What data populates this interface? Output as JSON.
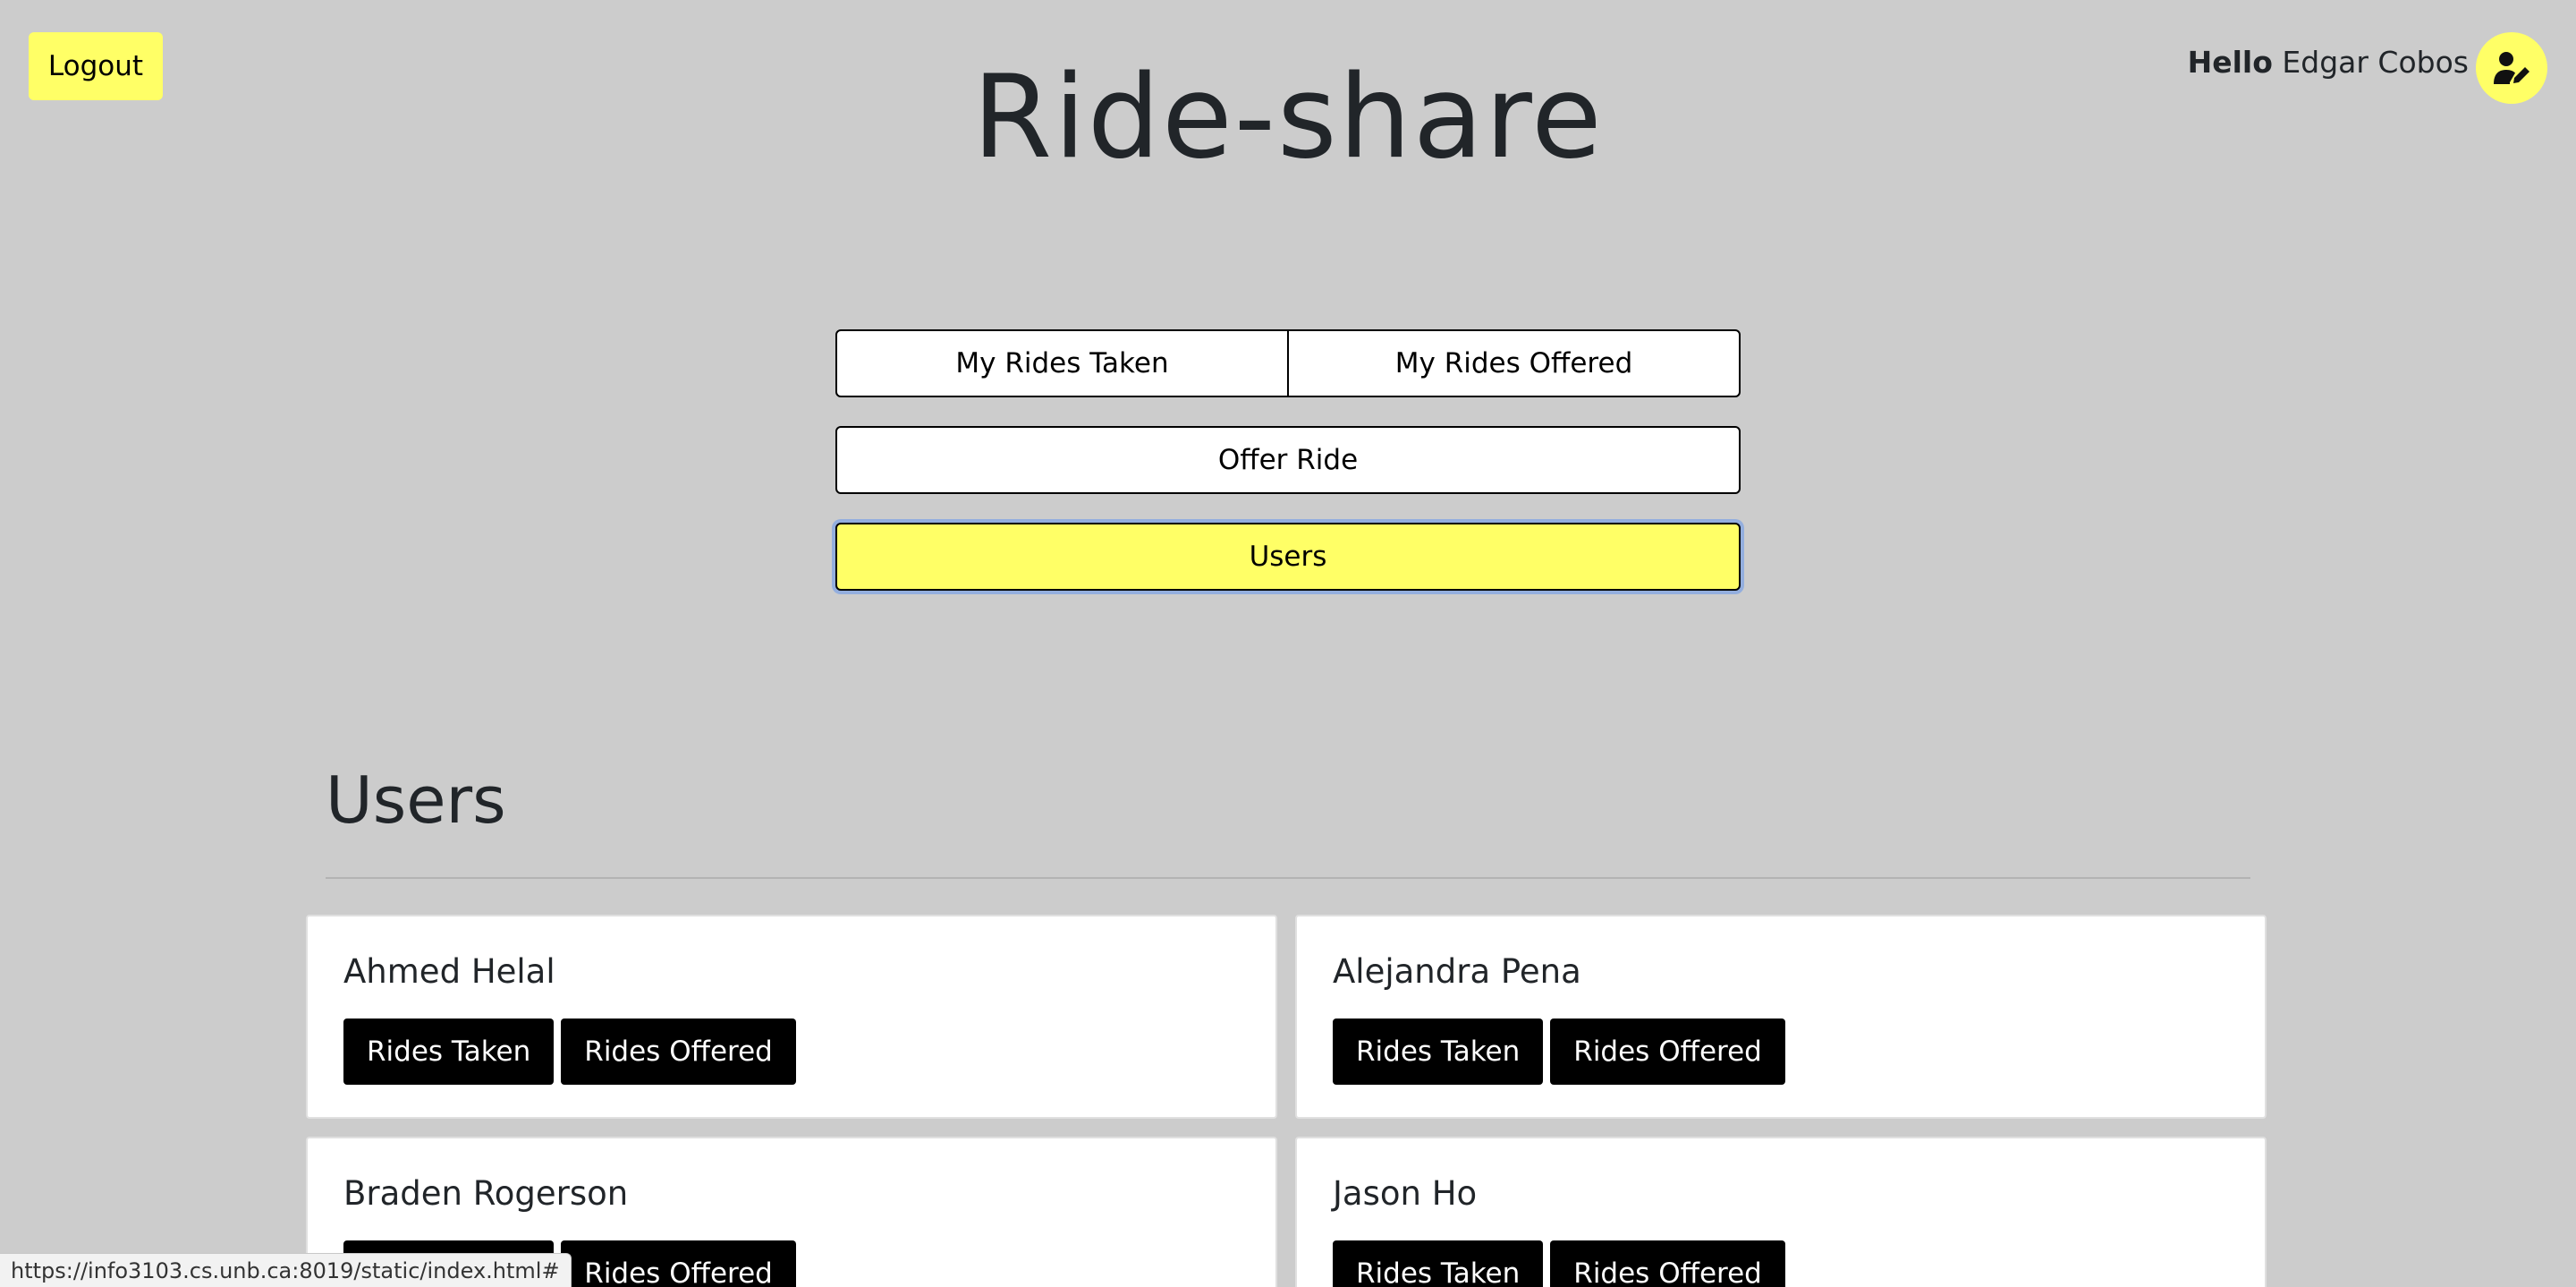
{
  "header": {
    "logout_label": "Logout",
    "greeting_hello": "Hello",
    "greeting_name": "Edgar Cobos",
    "avatar_icon": "user-edit-icon",
    "app_title": "Ride-share"
  },
  "nav": {
    "my_rides_taken": "My Rides Taken",
    "my_rides_offered": "My Rides Offered",
    "offer_ride": "Offer Ride",
    "users": "Users",
    "active": "Users"
  },
  "users_section": {
    "title": "Users",
    "users": [
      {
        "name": "Ahmed Helal",
        "rides_taken": "Rides Taken",
        "rides_offered": "Rides Offered"
      },
      {
        "name": "Alejandra Pena",
        "rides_taken": "Rides Taken",
        "rides_offered": "Rides Offered"
      },
      {
        "name": "Braden Rogerson",
        "rides_taken": "Rides Taken",
        "rides_offered": "Rides Offered"
      },
      {
        "name": "Jason Ho",
        "rides_taken": "Rides Taken",
        "rides_offered": "Rides Offered"
      }
    ]
  },
  "status_bar": {
    "url": "https://info3103.cs.unb.ca:8019/static/index.html#"
  },
  "colors": {
    "background": "#cccccc",
    "accent_yellow": "#ffff66",
    "button_dark": "#000000",
    "card_background": "#ffffff"
  }
}
